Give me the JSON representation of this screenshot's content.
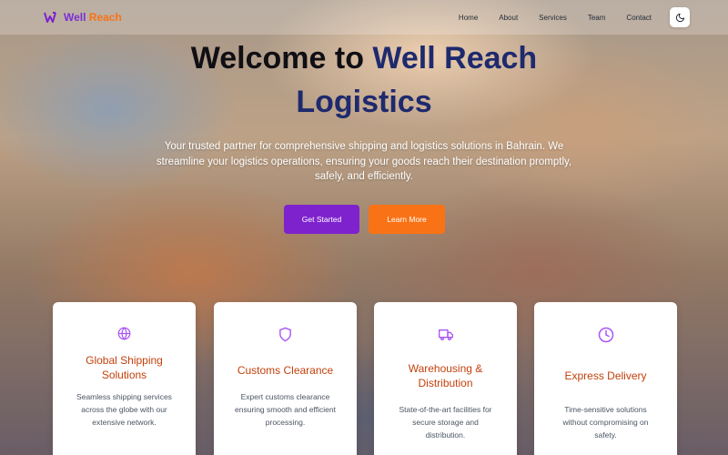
{
  "brand": {
    "name_part1": "Well",
    "name_part2": "Reach"
  },
  "nav": {
    "items": [
      {
        "label": "Home"
      },
      {
        "label": "About"
      },
      {
        "label": "Services"
      },
      {
        "label": "Team"
      },
      {
        "label": "Contact"
      }
    ],
    "theme_toggle_icon": "moon-icon"
  },
  "hero": {
    "title_part1": "Welcome to",
    "title_accent": "Well Reach",
    "title_part2": "Logistics",
    "subtitle": "Your trusted partner for comprehensive shipping and logistics solutions in Bahrain. We streamline your logistics operations, ensuring your goods reach their destination promptly, safely, and efficiently.",
    "primary_button": "Get Started",
    "secondary_button": "Learn More"
  },
  "services": [
    {
      "icon": "globe-icon",
      "title": "Global Shipping Solutions",
      "description": "Seamless shipping services across the globe with our extensive network."
    },
    {
      "icon": "shield-icon",
      "title": "Customs Clearance",
      "description": "Expert customs clearance ensuring smooth and efficient processing."
    },
    {
      "icon": "truck-icon",
      "title": "Warehousing & Distribution",
      "description": "State-of-the-art facilities for secure storage and distribution."
    },
    {
      "icon": "clock-icon",
      "title": "Express Delivery",
      "description": "Time-sensitive solutions without compromising on safety."
    }
  ],
  "colors": {
    "brand_purple": "#7e22ce",
    "brand_orange": "#f97316",
    "card_title": "#c2410c",
    "icon_purple": "#a855f7",
    "title_accent": "#1e2a6e"
  }
}
